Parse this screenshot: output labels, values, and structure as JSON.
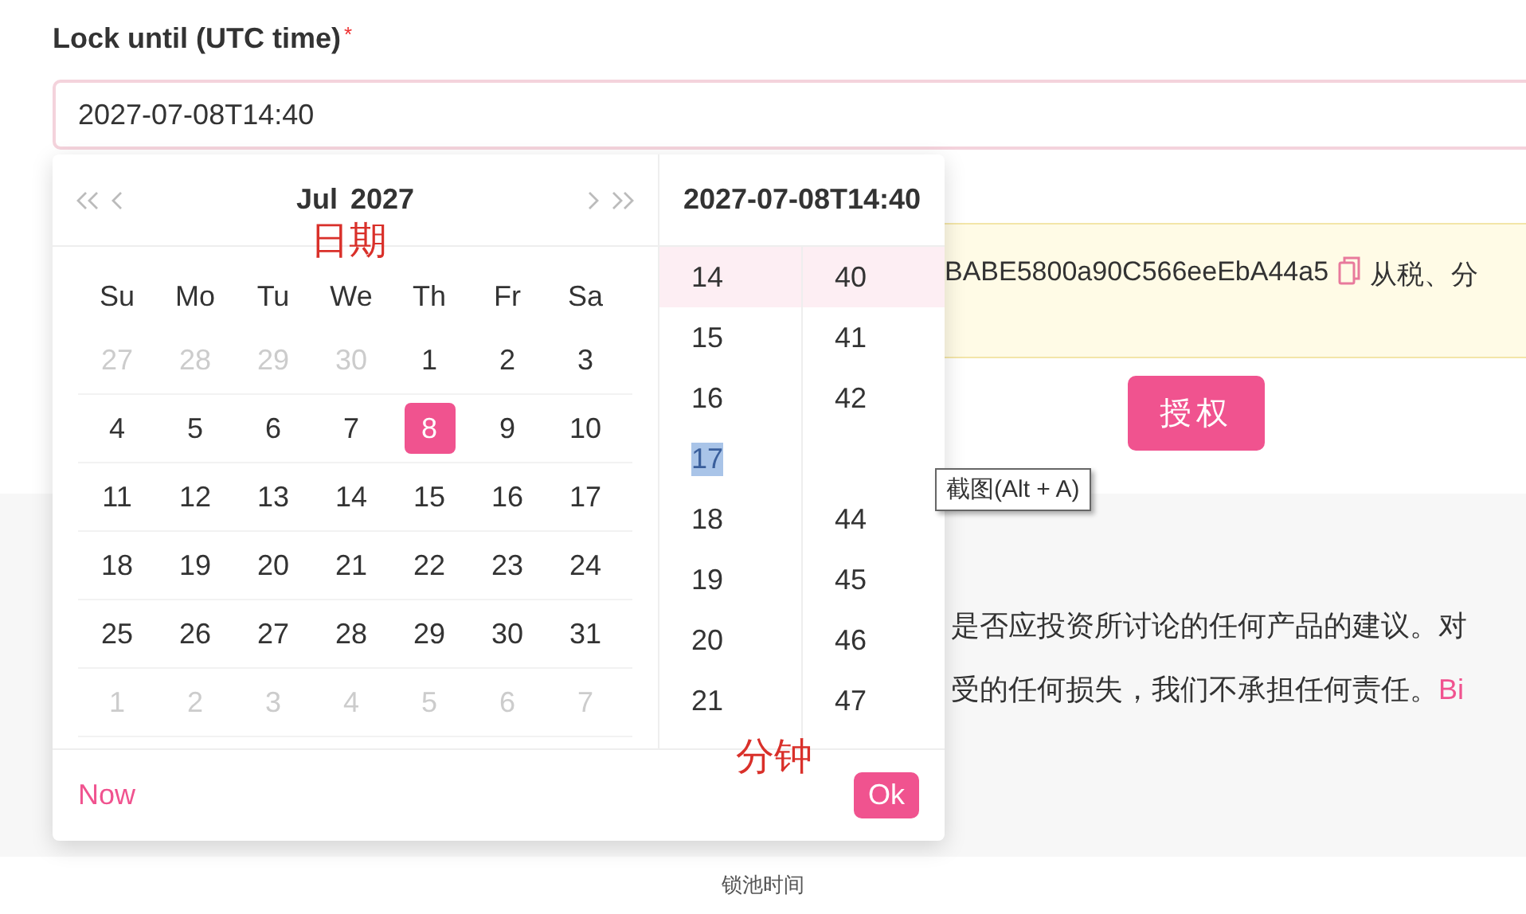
{
  "form": {
    "label": "Lock until (UTC time)",
    "required_mark": "*",
    "field": {
      "value": "2027-07-08T14:40"
    }
  },
  "banner": {
    "address": "BABE5800a90C566eeEbA44a5",
    "text": "从税、分"
  },
  "authorize_button": "授权",
  "disclaimer": {
    "line_1": "是否应投资所讨论的任何产品的建议。对",
    "line_2": "受的任何损失，我们不承担任何责任。",
    "link": "Bi"
  },
  "picker": {
    "month": "Jul",
    "year": "2027",
    "time_header": "2027-07-08T14:40",
    "weekdays": [
      "Su",
      "Mo",
      "Tu",
      "We",
      "Th",
      "Fr",
      "Sa"
    ],
    "weeks": [
      [
        {
          "label": "27",
          "other_month": true,
          "selected": false
        },
        {
          "label": "28",
          "other_month": true,
          "selected": false
        },
        {
          "label": "29",
          "other_month": true,
          "selected": false
        },
        {
          "label": "30",
          "other_month": true,
          "selected": false
        },
        {
          "label": "1",
          "other_month": false,
          "selected": false
        },
        {
          "label": "2",
          "other_month": false,
          "selected": false
        },
        {
          "label": "3",
          "other_month": false,
          "selected": false
        }
      ],
      [
        {
          "label": "4",
          "other_month": false,
          "selected": false
        },
        {
          "label": "5",
          "other_month": false,
          "selected": false
        },
        {
          "label": "6",
          "other_month": false,
          "selected": false
        },
        {
          "label": "7",
          "other_month": false,
          "selected": false
        },
        {
          "label": "8",
          "other_month": false,
          "selected": true
        },
        {
          "label": "9",
          "other_month": false,
          "selected": false
        },
        {
          "label": "10",
          "other_month": false,
          "selected": false
        }
      ],
      [
        {
          "label": "11",
          "other_month": false,
          "selected": false
        },
        {
          "label": "12",
          "other_month": false,
          "selected": false
        },
        {
          "label": "13",
          "other_month": false,
          "selected": false
        },
        {
          "label": "14",
          "other_month": false,
          "selected": false
        },
        {
          "label": "15",
          "other_month": false,
          "selected": false
        },
        {
          "label": "16",
          "other_month": false,
          "selected": false
        },
        {
          "label": "17",
          "other_month": false,
          "selected": false
        }
      ],
      [
        {
          "label": "18",
          "other_month": false,
          "selected": false
        },
        {
          "label": "19",
          "other_month": false,
          "selected": false
        },
        {
          "label": "20",
          "other_month": false,
          "selected": false
        },
        {
          "label": "21",
          "other_month": false,
          "selected": false
        },
        {
          "label": "22",
          "other_month": false,
          "selected": false
        },
        {
          "label": "23",
          "other_month": false,
          "selected": false
        },
        {
          "label": "24",
          "other_month": false,
          "selected": false
        }
      ],
      [
        {
          "label": "25",
          "other_month": false,
          "selected": false
        },
        {
          "label": "26",
          "other_month": false,
          "selected": false
        },
        {
          "label": "27",
          "other_month": false,
          "selected": false
        },
        {
          "label": "28",
          "other_month": false,
          "selected": false
        },
        {
          "label": "29",
          "other_month": false,
          "selected": false
        },
        {
          "label": "30",
          "other_month": false,
          "selected": false
        },
        {
          "label": "31",
          "other_month": false,
          "selected": false
        }
      ],
      [
        {
          "label": "1",
          "other_month": true,
          "selected": false
        },
        {
          "label": "2",
          "other_month": true,
          "selected": false
        },
        {
          "label": "3",
          "other_month": true,
          "selected": false
        },
        {
          "label": "4",
          "other_month": true,
          "selected": false
        },
        {
          "label": "5",
          "other_month": true,
          "selected": false
        },
        {
          "label": "6",
          "other_month": true,
          "selected": false
        },
        {
          "label": "7",
          "other_month": true,
          "selected": false
        }
      ]
    ],
    "hours": [
      {
        "label": "14",
        "selected": true,
        "highlighted": false
      },
      {
        "label": "15",
        "selected": false,
        "highlighted": false
      },
      {
        "label": "16",
        "selected": false,
        "highlighted": false
      },
      {
        "label": "17",
        "selected": false,
        "highlighted": true
      },
      {
        "label": "18",
        "selected": false,
        "highlighted": false
      },
      {
        "label": "19",
        "selected": false,
        "highlighted": false
      },
      {
        "label": "20",
        "selected": false,
        "highlighted": false
      },
      {
        "label": "21",
        "selected": false,
        "highlighted": false
      }
    ],
    "minutes": [
      {
        "kind": "value",
        "label": "40",
        "selected": true
      },
      {
        "kind": "value",
        "label": "41",
        "selected": false
      },
      {
        "kind": "value",
        "label": "42",
        "selected": false
      },
      {
        "kind": "blank"
      },
      {
        "kind": "value",
        "label": "44",
        "selected": false
      },
      {
        "kind": "value",
        "label": "45",
        "selected": false
      },
      {
        "kind": "value",
        "label": "46",
        "selected": false
      },
      {
        "kind": "value",
        "label": "47",
        "selected": false
      }
    ],
    "now_link": "Now",
    "ok_button": "Ok"
  },
  "annotations": [
    {
      "text": "日期"
    },
    {
      "text": "分钟"
    }
  ],
  "tooltip": "截图(Alt + A)",
  "caption": "锁池时间"
}
